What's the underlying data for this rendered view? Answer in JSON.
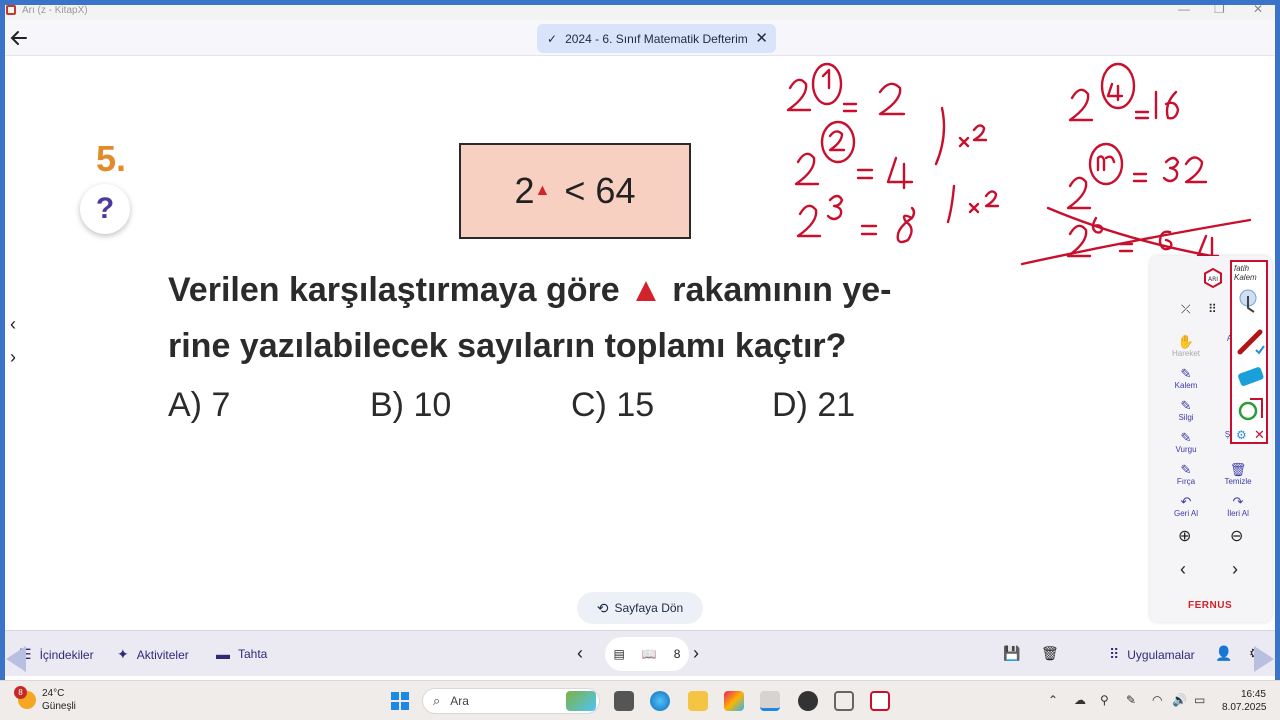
{
  "window": {
    "title": "Arı (z - KitapX)",
    "min": "—",
    "max": "❐",
    "close": "✕"
  },
  "header": {
    "document_title": "2024 - 6. Sınıf Matematik Defterim",
    "check_icon": "check-icon",
    "close_glyph": "✕"
  },
  "question": {
    "number": "5.",
    "help": "?",
    "formula_base": "2",
    "formula_symbol": "▲",
    "formula_rest": "< 64",
    "text_line1_a": "Verilen karşılaştırmaya göre",
    "text_symbol": "▲",
    "text_line1_b": "rakamının ye-",
    "text_line2": "rine yazılabilecek sayıların toplamı kaçtır?",
    "options": [
      {
        "label": "A) 7"
      },
      {
        "label": "B) 10"
      },
      {
        "label": "C) 15"
      },
      {
        "label": "D) 21"
      }
    ]
  },
  "nav": {
    "prev": "‹",
    "next": "›"
  },
  "tools": {
    "items": [
      {
        "label": "Hareket",
        "icon": "hand-icon"
      },
      {
        "label": "Kalem",
        "icon": "pen-icon"
      },
      {
        "label": "Silgi",
        "icon": "eraser-icon"
      },
      {
        "label": "Vurgu",
        "icon": "highlight-icon"
      },
      {
        "label": "Fırça",
        "icon": "brush-icon"
      },
      {
        "label": "Geri Al",
        "icon": "undo-icon"
      },
      {
        "label": "Al",
        "icon": "cut-icon"
      },
      {
        "label": "Şekiller",
        "icon": "shapes-icon"
      },
      {
        "label": "Temizle",
        "icon": "trash-icon"
      },
      {
        "label": "İleri Al",
        "icon": "redo-icon"
      }
    ],
    "brand": "FERNUS"
  },
  "fatih": {
    "brand": "fatih Kalem"
  },
  "return_button": {
    "label": "Sayfaya Dön"
  },
  "bottom": {
    "contents": "İçindekiler",
    "activities": "Aktiviteler",
    "board": "Tahta",
    "page": "8",
    "apps": "Uygulamalar"
  },
  "taskbar": {
    "weather_badge": "8",
    "temp": "24°C",
    "condition": "Güneşli",
    "search_placeholder": "Ara",
    "time": "16:45",
    "date": "8.07.2025"
  }
}
